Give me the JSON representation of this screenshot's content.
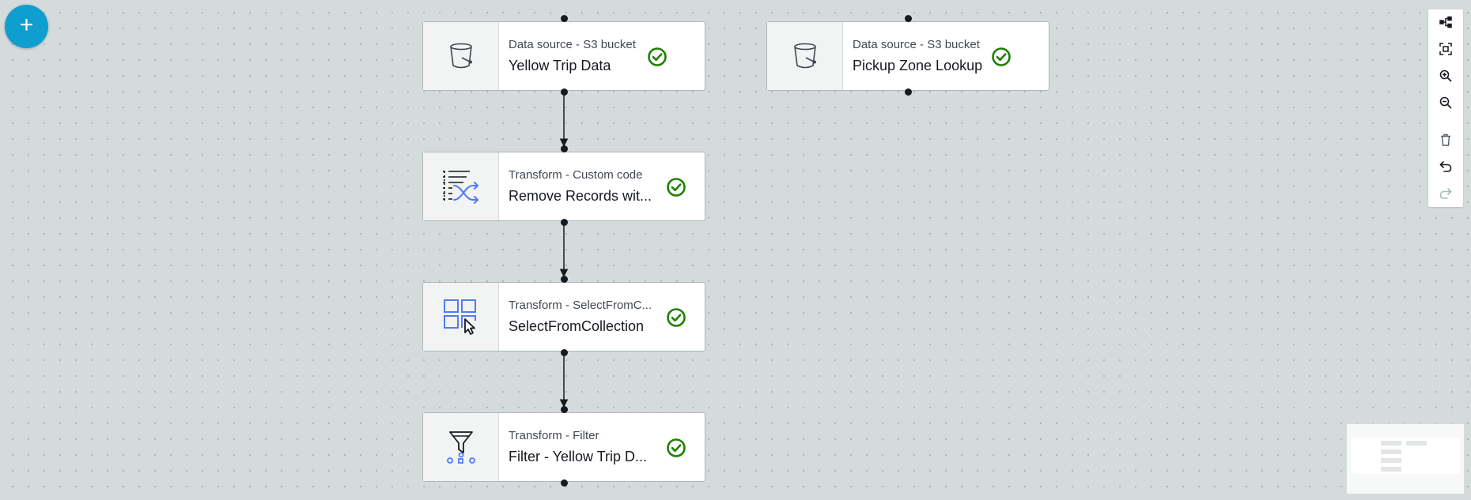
{
  "toolbar": {
    "add_label": "+",
    "tools": [
      {
        "name": "layout-icon"
      },
      {
        "name": "fit-to-screen-icon"
      },
      {
        "name": "zoom-in-icon"
      },
      {
        "name": "zoom-out-icon"
      },
      {
        "name": "delete-icon"
      },
      {
        "name": "undo-icon"
      },
      {
        "name": "redo-icon"
      }
    ]
  },
  "nodes": [
    {
      "type": "Data source - S3 bucket",
      "name": "Yellow Trip Data",
      "icon": "s3-bucket-icon",
      "status": "success-check-icon"
    },
    {
      "type": "Data source - S3 bucket",
      "name": "Pickup Zone Lookup",
      "icon": "s3-bucket-icon",
      "status": "success-check-icon"
    },
    {
      "type": "Transform - Custom code",
      "name": "Remove Records wit...",
      "icon": "custom-code-transform-icon",
      "status": "success-check-icon"
    },
    {
      "type": "Transform - SelectFromC...",
      "name": "SelectFromCollection",
      "icon": "select-from-collection-icon",
      "status": "success-check-icon"
    },
    {
      "type": "Transform - Filter",
      "name": "Filter - Yellow Trip D...",
      "icon": "filter-icon",
      "status": "success-check-icon"
    }
  ],
  "colors": {
    "canvas": "#d5dbdb",
    "accent": "#0f9fcf",
    "success": "#1d8102",
    "transform_icon": "#4f7cf7",
    "edge": "#16191f"
  }
}
